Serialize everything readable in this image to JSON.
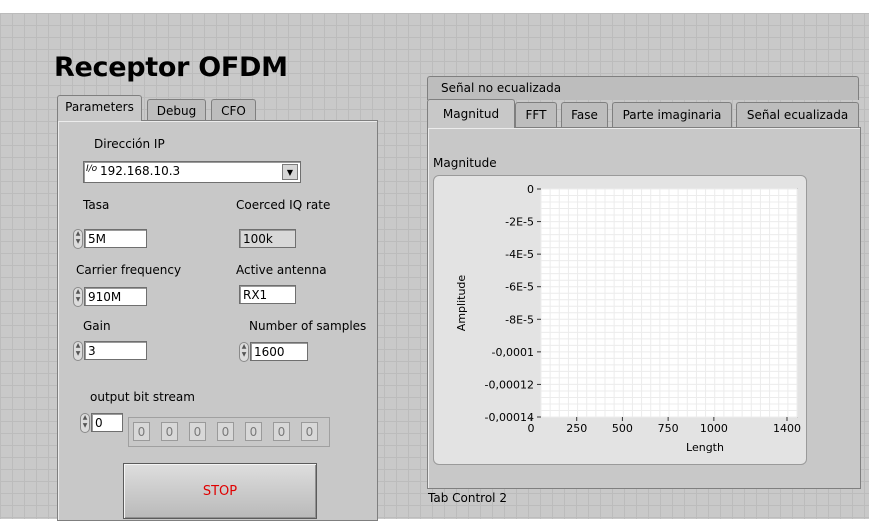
{
  "title": "Receptor OFDM",
  "left_tabs": [
    "Parameters",
    "Debug",
    "CFO"
  ],
  "params": {
    "ip_label": "Dirección IP",
    "ip_icon_text": "I/o",
    "ip_value": "192.168.10.3",
    "tasa_label": "Tasa",
    "tasa_value": "5M",
    "coerced_label": "Coerced IQ rate",
    "coerced_value": "100k",
    "carrier_label": "Carrier frequency",
    "carrier_value": "910M",
    "antenna_label": "Active antenna",
    "antenna_value": "RX1",
    "gain_label": "Gain",
    "gain_value": "3",
    "samples_label": "Number of samples",
    "samples_value": "1600",
    "bitstream_label": "output bit stream",
    "bitstream_index": "0",
    "bitstream_values": [
      "0",
      "0",
      "0",
      "0",
      "0",
      "0",
      "0"
    ]
  },
  "stop_label": "STOP",
  "right_tabs_row1": [
    "Señal no ecualizada"
  ],
  "right_tabs_row2": [
    "Magnitud",
    "FFT",
    "Fase",
    "Parte imaginaria",
    "Señal ecualizada"
  ],
  "graph_title": "Magnitude",
  "tab_control_label": "Tab Control 2",
  "icons": {
    "dropdown": "chevron-down-icon",
    "spin": "increment-decrement-icon"
  },
  "colors": {
    "stop_text": "#e00000",
    "background": "#c9c9c9"
  },
  "chart_data": {
    "type": "line",
    "title": "Magnitude",
    "xlabel": "Length",
    "ylabel": "Amplitude",
    "xlim": [
      0,
      1400
    ],
    "ylim": [
      -0.00014,
      0
    ],
    "x_ticks": [
      0,
      250,
      500,
      750,
      1000,
      1400
    ],
    "x_tick_labels": [
      "0",
      "250",
      "500",
      "750",
      "1000",
      "1400"
    ],
    "y_ticks": [
      0,
      -2e-05,
      -4e-05,
      -6e-05,
      -8e-05,
      -0.0001,
      -0.00012,
      -0.00014
    ],
    "y_tick_labels": [
      "0",
      "-2E-5",
      "-4E-5",
      "-6E-5",
      "-8E-5",
      "-0,0001",
      "-0,00012",
      "-0,00014"
    ],
    "grid": true,
    "series": []
  }
}
